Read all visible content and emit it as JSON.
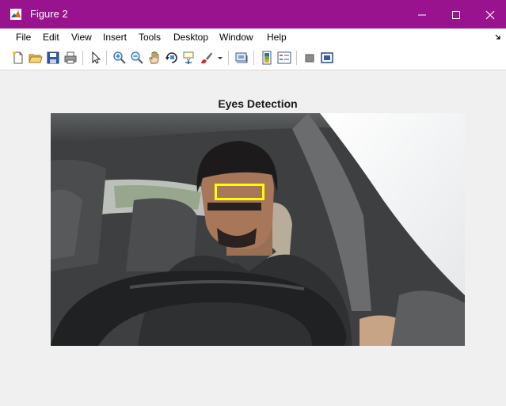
{
  "window": {
    "title": "Figure 2",
    "controls": [
      "minimize-icon",
      "maximize-icon",
      "close-icon"
    ],
    "accent_color": "#99138f"
  },
  "menu": {
    "items": [
      "File",
      "Edit",
      "View",
      "Insert",
      "Tools",
      "Desktop",
      "Window",
      "Help"
    ],
    "corner_icon": "dock-arrow-icon"
  },
  "toolbar": {
    "tools": [
      "new-figure-icon",
      "open-file-icon",
      "save-icon",
      "print-icon",
      "edit-plot-arrow-icon",
      "zoom-in-icon",
      "zoom-out-icon",
      "pan-hand-icon",
      "rotate-3d-icon",
      "data-cursor-icon",
      "brush-icon",
      "brush-dropdown-icon",
      "link-plot-icon",
      "insert-colorbar-icon",
      "insert-legend-icon",
      "hide-plot-tools-icon",
      "show-plot-tools-icon"
    ]
  },
  "figure": {
    "axes_title": "Eyes Detection",
    "image_content": "photo of driver in car with steering wheel",
    "detection_box_color": "#ffff00"
  }
}
